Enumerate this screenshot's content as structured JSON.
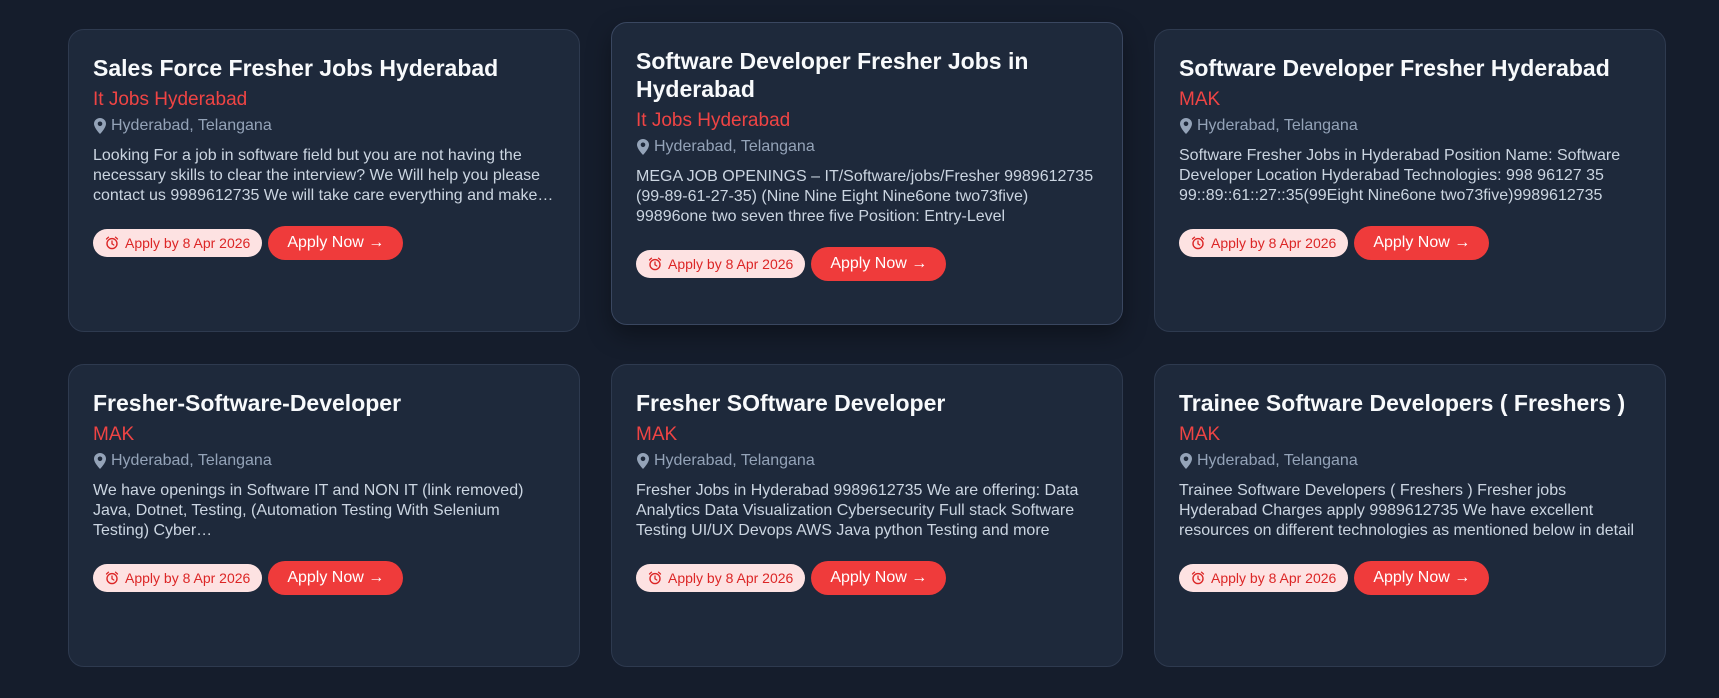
{
  "jobs": [
    {
      "title": "Sales Force Fresher Jobs Hyderabad",
      "company": "It Jobs Hyderabad",
      "location": "Hyderabad, Telangana",
      "description": "Looking For a job in software field but you are not having the necessary skills to clear the interview? We Will help you please contact us 9989612735 We will take care everything and make you job ready.",
      "deadline": "Apply by 8 Apr 2026",
      "apply_label": "Apply Now →"
    },
    {
      "title": "Software Developer Fresher Jobs in Hyderabad",
      "company": "It Jobs Hyderabad",
      "location": "Hyderabad, Telangana",
      "description": "MEGA JOB OPENINGS – IT/Software/jobs/Fresher 9989612735 (99-89-61-27-35) (Nine Nine Eight Nine6one two73five) 99896one two seven three five Position: Entry-Level",
      "deadline": "Apply by 8 Apr 2026",
      "apply_label": "Apply Now →"
    },
    {
      "title": "Software Developer Fresher Hyderabad",
      "company": "MAK",
      "location": "Hyderabad, Telangana",
      "description": "Software Fresher Jobs in Hyderabad Position Name: Software Developer Location Hyderabad Technologies: 998 96127 35 99::89::61::27::35(99Eight Nine6one two73five)9989612735",
      "deadline": "Apply by 8 Apr 2026",
      "apply_label": "Apply Now →"
    },
    {
      "title": "Fresher-Software-Developer",
      "company": "MAK",
      "location": "Hyderabad, Telangana",
      "description": "We have openings in Software IT and NON IT (link removed) Java, Dotnet, Testing, (Automation Testing With Selenium Testing) Cyber…",
      "deadline": "Apply by 8 Apr 2026",
      "apply_label": "Apply Now →"
    },
    {
      "title": "Fresher SOftware Developer",
      "company": "MAK",
      "location": "Hyderabad, Telangana",
      "description": "Fresher Jobs in Hyderabad 9989612735 We are offering: Data Analytics Data Visualization Cybersecurity Full stack Software Testing UI/UX Devops AWS Java python Testing and more",
      "deadline": "Apply by 8 Apr 2026",
      "apply_label": "Apply Now →"
    },
    {
      "title": "Trainee Software Developers ( Freshers )",
      "company": "MAK",
      "location": "Hyderabad, Telangana",
      "description": "Trainee Software Developers ( Freshers ) Fresher jobs Hyderabad Charges apply 9989612735 We have excellent resources on different technologies as mentioned below in detail",
      "deadline": "Apply by 8 Apr 2026",
      "apply_label": "Apply Now →"
    }
  ],
  "icons": {
    "location": "location-pin-icon",
    "deadline": "alarm-clock-icon"
  },
  "colors": {
    "background": "#151d2c",
    "card": "#1e293b",
    "accent": "#ef3b3b",
    "company": "#ef4444",
    "deadline_bg": "#fde2e2"
  }
}
